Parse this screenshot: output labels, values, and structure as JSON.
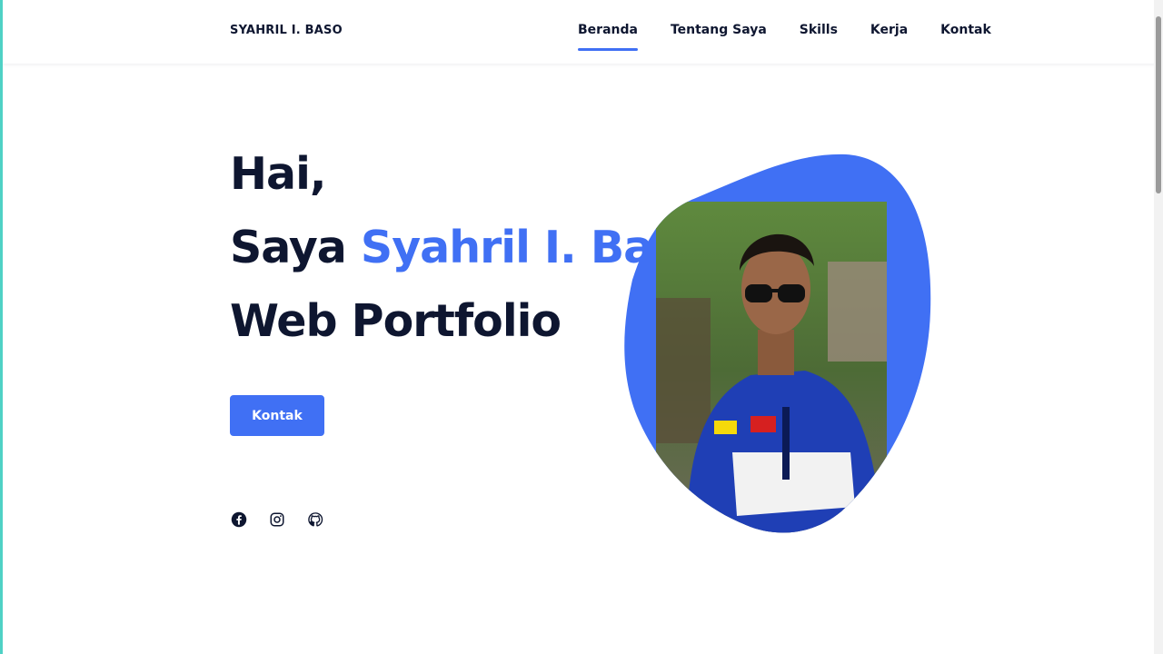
{
  "header": {
    "brand": "SYAHRIL I. BASO",
    "nav": [
      {
        "label": "Beranda",
        "active": true
      },
      {
        "label": "Tentang Saya",
        "active": false
      },
      {
        "label": "Skills",
        "active": false
      },
      {
        "label": "Kerja",
        "active": false
      },
      {
        "label": "Kontak",
        "active": false
      }
    ]
  },
  "hero": {
    "line1": "Hai,",
    "line2_prefix": "Saya",
    "line2_name": "Syahril I. Baso",
    "line3": "Web Portfolio",
    "button_label": "Kontak",
    "socials": [
      "facebook-icon",
      "instagram-icon",
      "github-icon"
    ]
  },
  "colors": {
    "accent": "#4070f4",
    "text": "#0e1630",
    "side_border": "#4fd1c5"
  }
}
